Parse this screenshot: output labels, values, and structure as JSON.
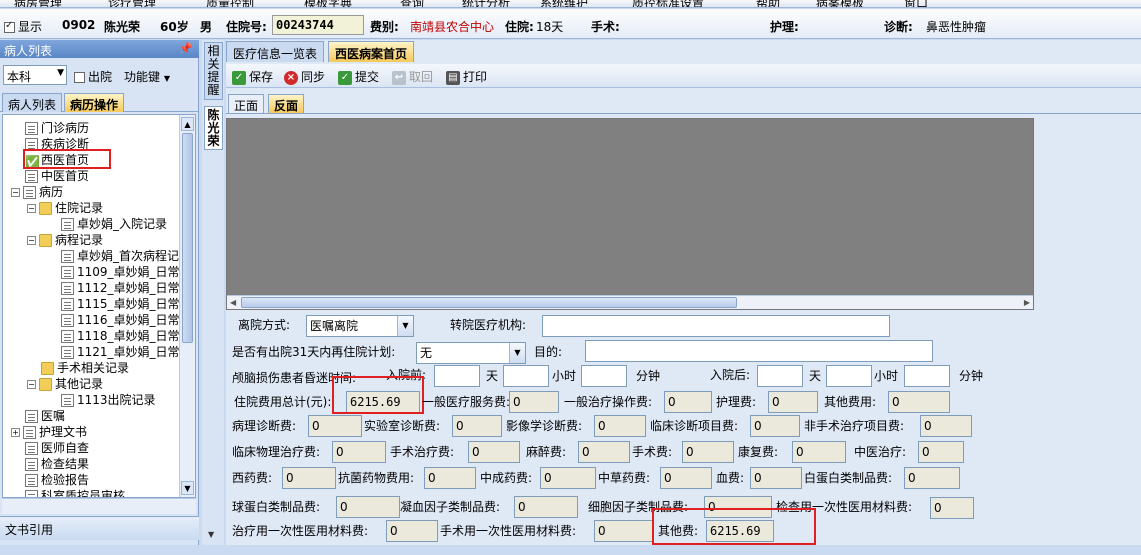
{
  "menu": [
    "病房管理",
    "诊疗管理",
    "质量控制",
    "模板字典",
    "查询",
    "统计分析",
    "系统维护",
    "质控标准设置",
    "帮助",
    "病案模板",
    "窗口"
  ],
  "patient": {
    "show_label": "显示",
    "bed": "0902",
    "name": "陈光荣",
    "age": "60岁",
    "sex": "男",
    "inpatient_no_label": "住院号:",
    "inpatient_no": "00243744",
    "fee_type_label": "费别:",
    "fee_type": "南靖县农合中心",
    "stay_label": "住院:",
    "stay": "18天",
    "surgery_label": "手术:",
    "nursing_label": "护理:",
    "diagnosis_label": "诊断:",
    "diagnosis": "鼻恶性肿瘤"
  },
  "left": {
    "title": "病人列表",
    "pin": "ᵖ",
    "dept": "本科",
    "discharged": "出院",
    "func": "功能键",
    "tab_list": "病人列表",
    "tab_records": "病历操作",
    "footer": "文书引用"
  },
  "tree": [
    {
      "label": "门诊病历",
      "icon": "doc"
    },
    {
      "label": "疾病诊断",
      "icon": "doc"
    },
    {
      "label": "西医首页",
      "icon": "check"
    },
    {
      "label": "中医首页",
      "icon": "doc"
    },
    {
      "label": "病历",
      "icon": "doc"
    },
    {
      "label": "住院记录",
      "icon": "folder"
    },
    {
      "label": "卓妙娟_入院记录",
      "icon": "doc"
    },
    {
      "label": "病程记录",
      "icon": "folder"
    },
    {
      "label": "卓妙娟_首次病程记",
      "icon": "doc"
    },
    {
      "label": "1109_卓妙娟_日常",
      "icon": "doc"
    },
    {
      "label": "1112_卓妙娟_日常",
      "icon": "doc"
    },
    {
      "label": "1115_卓妙娟_日常",
      "icon": "doc"
    },
    {
      "label": "1116_卓妙娟_日常",
      "icon": "doc"
    },
    {
      "label": "1118_卓妙娟_日常",
      "icon": "doc"
    },
    {
      "label": "1121_卓妙娟_日常",
      "icon": "doc"
    },
    {
      "label": "手术相关记录",
      "icon": "folder"
    },
    {
      "label": "其他记录",
      "icon": "folder"
    },
    {
      "label": "1113出院记录",
      "icon": "doc"
    },
    {
      "label": "医嘱",
      "icon": "doc"
    },
    {
      "label": "护理文书",
      "icon": "doc"
    },
    {
      "label": "医师自查",
      "icon": "doc"
    },
    {
      "label": "检查结果",
      "icon": "doc"
    },
    {
      "label": "检验报告",
      "icon": "doc"
    },
    {
      "label": "科室质控员审核",
      "icon": "doc"
    }
  ],
  "sidetabs": {
    "remind": "相关提醒",
    "patient": "陈光荣"
  },
  "tabs": {
    "overview": "医疗信息一览表",
    "western": "西医病案首页"
  },
  "toolbar": {
    "save": "保存",
    "sync": "同步",
    "submit": "提交",
    "retrieve": "取回",
    "print": "打印"
  },
  "subtabs": {
    "front": "正面",
    "back": "反面"
  },
  "form": {
    "discharge_method_label": "离院方式:",
    "discharge_method": "医嘱离院",
    "transfer_label": "转院医疗机构:",
    "readmit_label": "是否有出院31天内再住院计划:",
    "readmit": "无",
    "purpose_label": "目的:",
    "coma_label": "颅脑损伤患者昏迷时间:",
    "before_label": "入院前:",
    "after_label": "入院后:",
    "day": "天",
    "hour": "小时",
    "minute": "分钟",
    "total_label": "住院费用总计(元):",
    "total": "6215.69",
    "general_service_label": "一般医疗服务费:",
    "general_service": "0",
    "general_treat_label": "一般治疗操作费:",
    "general_treat": "0",
    "nursing_fee_label": "护理费:",
    "nursing_fee": "0",
    "other_fee_label": "其他费用:",
    "other_fee": "0",
    "pathology_label": "病理诊断费:",
    "pathology": "0",
    "lab_label": "实验室诊断费:",
    "lab": "0",
    "imaging_label": "影像学诊断费:",
    "imaging": "0",
    "clinical_dx_label": "临床诊断项目费:",
    "clinical_dx": "0",
    "nonsurg_label": "非手术治疗项目费:",
    "nonsurg": "0",
    "physio_label": "临床物理治疗费:",
    "physio": "0",
    "surg_treat_label": "手术治疗费:",
    "surg_treat": "0",
    "anesth_label": "麻醉费:",
    "anesth": "0",
    "surgery_fee_label": "手术费:",
    "surgery_fee": "0",
    "rehab_label": "康复费:",
    "rehab": "0",
    "tcm_treat_label": "中医治疗:",
    "tcm_treat": "0",
    "western_drug_label": "西药费:",
    "western_drug": "0",
    "antibiotic_label": "抗菌药物费用:",
    "antibiotic": "0",
    "patent_drug_label": "中成药费:",
    "patent_drug": "0",
    "herbal_label": "中草药费:",
    "herbal": "0",
    "blood_label": "血费:",
    "blood": "0",
    "albumin_label": "白蛋白类制品费:",
    "albumin": "0",
    "globulin_label": "球蛋白类制品费:",
    "globulin": "0",
    "coag_label": "凝血因子类制品费:",
    "coag": "0",
    "cytokine_label": "细胞因子类制品费:",
    "cytokine": "0",
    "exam_consumable_label": "检查用一次性医用材料费:",
    "exam_consumable": "0",
    "treat_consumable_label": "治疗用一次性医用材料费:",
    "treat_consumable": "0",
    "surg_consumable_label": "手术用一次性医用材料费:",
    "surg_consumable": "0",
    "other_label": "其他费:",
    "other": "6215.69"
  }
}
